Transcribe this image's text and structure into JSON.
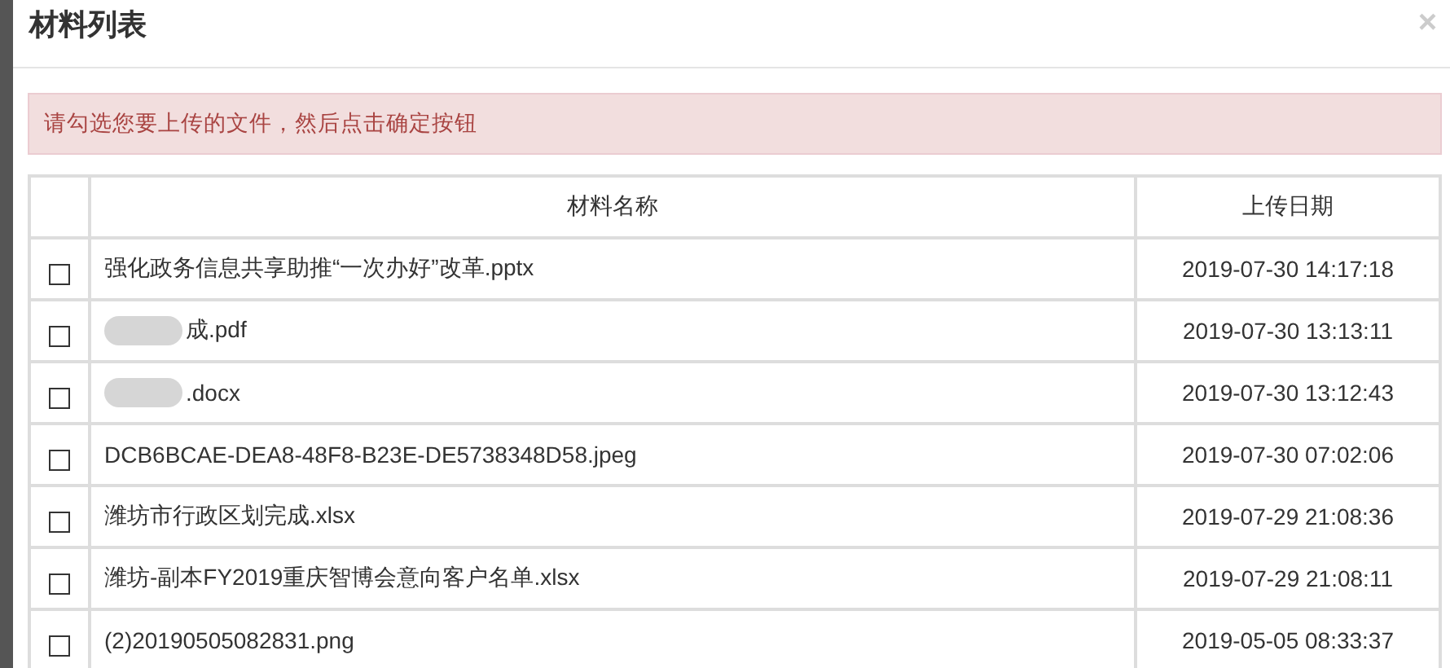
{
  "dialog": {
    "title": "材料列表",
    "close": "×"
  },
  "alert": {
    "message": "请勾选您要上传的文件，然后点击确定按钮"
  },
  "table": {
    "columns": [
      "材料名称",
      "上传日期"
    ],
    "rows": [
      {
        "checked": false,
        "name": "强化政务信息共享助推“一次办好”改革.pptx",
        "date": "2019-07-30 14:17:18",
        "redacted": false
      },
      {
        "checked": false,
        "name": "成.pdf",
        "date": "2019-07-30 13:13:11",
        "redacted": true
      },
      {
        "checked": false,
        "name": ".docx",
        "date": "2019-07-30 13:12:43",
        "redacted": true
      },
      {
        "checked": false,
        "name": "DCB6BCAE-DEA8-48F8-B23E-DE5738348D58.jpeg",
        "date": "2019-07-30 07:02:06",
        "redacted": false
      },
      {
        "checked": false,
        "name": "潍坊市行政区划完成.xlsx",
        "date": "2019-07-29 21:08:36",
        "redacted": false
      },
      {
        "checked": false,
        "name": "潍坊-副本FY2019重庆智博会意向客户名单.xlsx",
        "date": "2019-07-29 21:08:11",
        "redacted": false
      },
      {
        "checked": false,
        "name": "(2)20190505082831.png",
        "date": "2019-05-05 08:33:37",
        "redacted": false
      }
    ]
  }
}
